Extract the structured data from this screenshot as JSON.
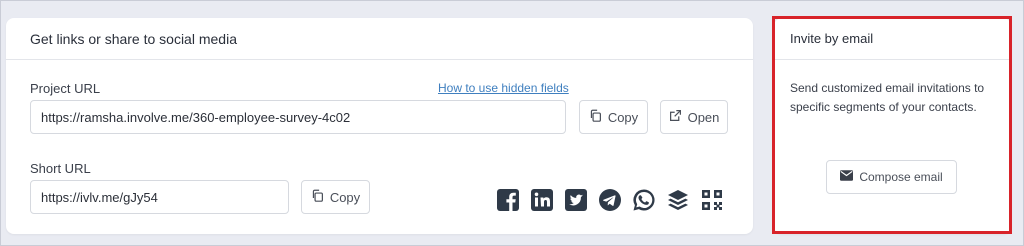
{
  "links_card": {
    "title": "Get links or share to social media",
    "project_url": {
      "label": "Project URL",
      "help_link": "How to use hidden fields",
      "value": "https://ramsha.involve.me/360-employee-survey-4c02",
      "copy_label": "Copy",
      "open_label": "Open"
    },
    "short_url": {
      "label": "Short URL",
      "value": "https://ivlv.me/gJy54",
      "copy_label": "Copy"
    },
    "social_icons": [
      "facebook-icon",
      "linkedin-icon",
      "twitter-icon",
      "telegram-icon",
      "whatsapp-icon",
      "buffer-icon",
      "qr-code-icon"
    ]
  },
  "invite_card": {
    "title": "Invite by email",
    "description": "Send customized email invitations to specific segments of your contacts.",
    "compose_label": "Compose email"
  },
  "colors": {
    "background": "#e9ebf2",
    "link": "#3f7fbf",
    "highlight": "#d8232a",
    "social_icon": "#2f3a48"
  }
}
